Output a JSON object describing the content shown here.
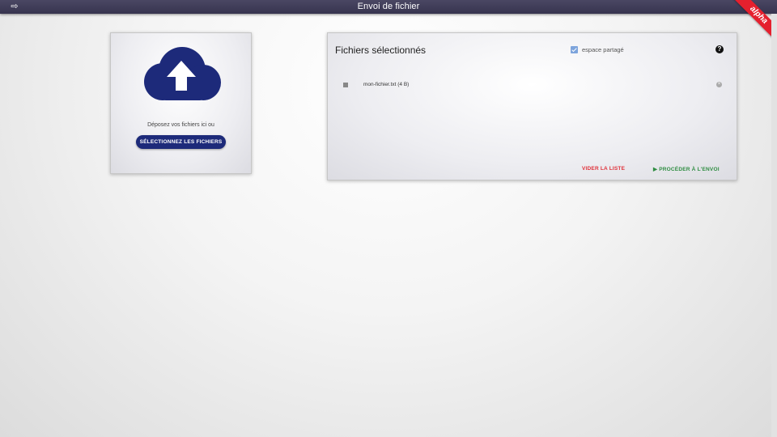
{
  "app": {
    "title": "Envoi de fichier",
    "badge": "alpha",
    "menu_icon": "arrow-bar-right-icon"
  },
  "upload": {
    "icon": "cloud-upload-icon",
    "drop_text": "Déposez vos fichiers ici ou",
    "select_label": "SÉLECTIONNEZ LES FICHIERS"
  },
  "files": {
    "title": "Fichiers sélectionnés",
    "shared_label": "espace partagé",
    "shared_checked": true,
    "help_icon": "question-icon",
    "items": [
      {
        "name": "mon-fichier.txt (4 B)"
      }
    ],
    "clear_label": "VIDER LA LISTE",
    "proceed_label": "PROCÉDER À L'ENVOI"
  },
  "colors": {
    "topbar": "#3c3955",
    "primary": "#1d2a7a",
    "danger": "#e0313a",
    "success": "#2f8d42",
    "ribbon": "#e5202e"
  }
}
